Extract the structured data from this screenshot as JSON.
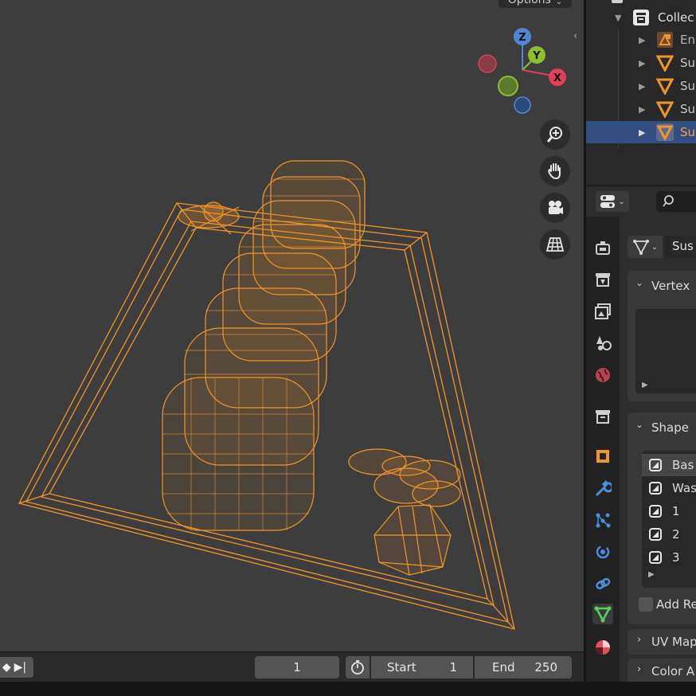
{
  "viewport": {
    "options_label": "Options",
    "gizmo": {
      "x": "X",
      "y": "Y",
      "z": "Z"
    },
    "nav_icons": [
      "zoom-icon",
      "hand-pan-icon",
      "camera-icon",
      "grid-icon"
    ],
    "wire_color": "#f0952a"
  },
  "timeline": {
    "current_frame": "1",
    "start_label": "Start",
    "start_value": "1",
    "end_label": "End",
    "end_value": "250"
  },
  "outliner": {
    "items": [
      {
        "label": "Collec",
        "icon": "collection-icon"
      },
      {
        "label": "En",
        "icon": "empty-icon"
      },
      {
        "label": "Su",
        "icon": "mesh-icon"
      },
      {
        "label": "Su",
        "icon": "mesh-icon"
      },
      {
        "label": "Su",
        "icon": "mesh-icon"
      },
      {
        "label": "Su",
        "icon": "mesh-icon"
      }
    ]
  },
  "properties": {
    "object_name": "Sus",
    "vertex_groups_title": "Vertex",
    "shape_keys_title": "Shape",
    "shape_keys": [
      "Bas",
      "Was",
      "1",
      "2",
      "3"
    ],
    "add_rest_label": "Add Re",
    "uv_maps_title": "UV Map",
    "color_attr_title": "Color A"
  },
  "colors": {
    "selection": "#334d80",
    "accent_orange": "#f0952a",
    "active_tab_green": "#5ad35a"
  }
}
